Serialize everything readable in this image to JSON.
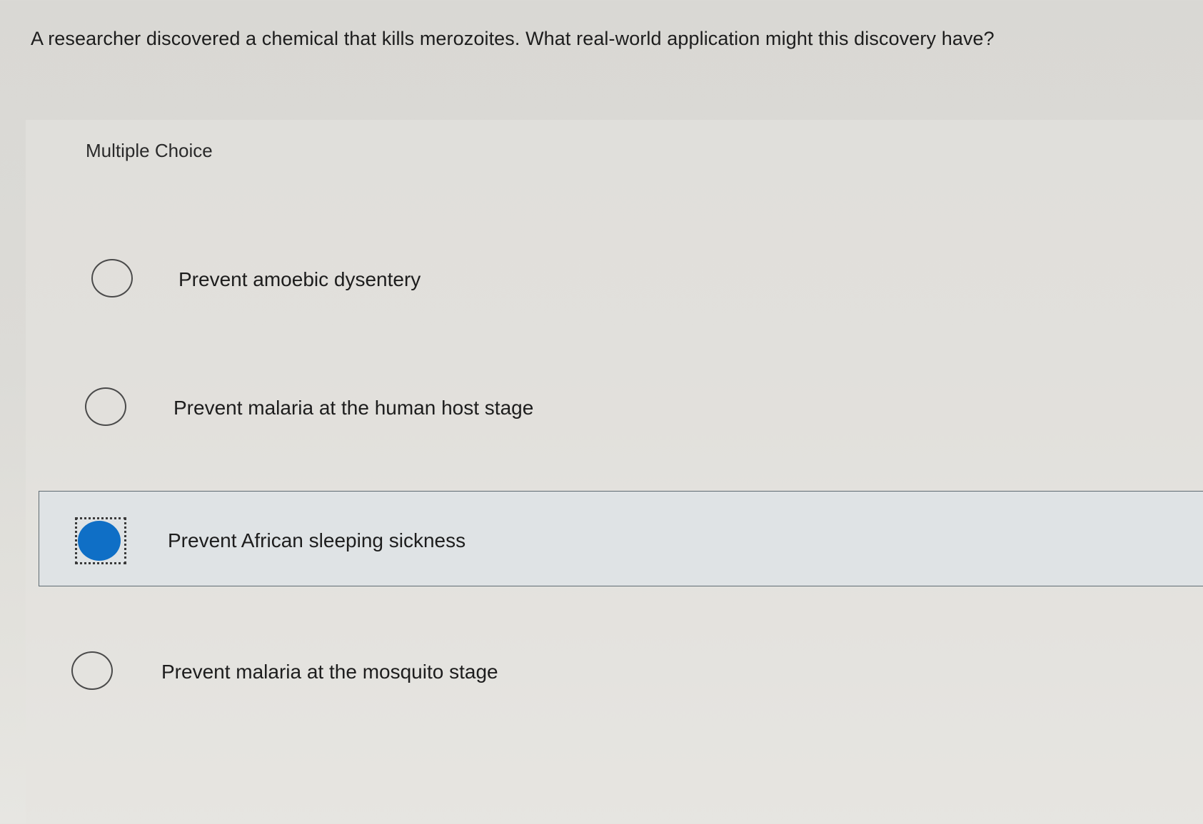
{
  "question": {
    "text": "A researcher discovered a chemical that kills merozoites. What real-world application might this discovery have?"
  },
  "choices": {
    "header": "Multiple Choice",
    "options": [
      {
        "label": "Prevent amoebic dysentery",
        "selected": false
      },
      {
        "label": "Prevent malaria at the human host stage",
        "selected": false
      },
      {
        "label": "Prevent African sleeping sickness",
        "selected": true
      },
      {
        "label": "Prevent malaria at the mosquito stage",
        "selected": false
      }
    ]
  },
  "colors": {
    "selected_radio": "#0f6fc6",
    "selected_background": "#dfe3e5"
  }
}
